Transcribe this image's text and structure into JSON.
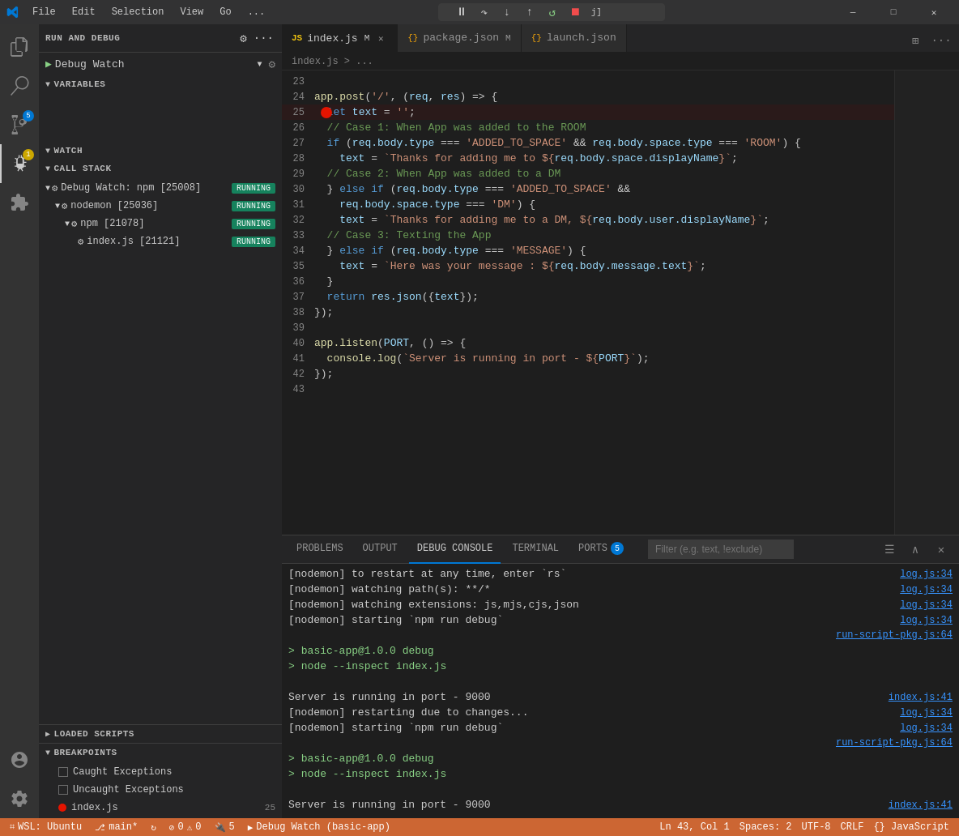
{
  "titleBar": {
    "menus": [
      "File",
      "Edit",
      "Selection",
      "View",
      "Go",
      "..."
    ],
    "windowControls": [
      "—",
      "□",
      "✕"
    ],
    "searchPlaceholder": ""
  },
  "debugControls": {
    "pause": "⏸",
    "stepOver": "↷",
    "stepInto": "↓",
    "stepOut": "↑",
    "restart": "↺",
    "stop": "⏹",
    "configLabel": "j]"
  },
  "activityBar": {
    "icons": [
      "explorer",
      "search",
      "source-control",
      "debug",
      "extensions",
      "accounts",
      "settings"
    ]
  },
  "sidebar": {
    "runDebugTitle": "RUN AND DEBUG",
    "debugConfig": "Debug Watch",
    "sections": {
      "variables": "VARIABLES",
      "watch": "WATCH",
      "callStack": "CALL STACK",
      "loadedScripts": "LOADED SCRIPTS",
      "breakpoints": "BREAKPOINTS"
    },
    "callStack": {
      "items": [
        {
          "label": "Debug Watch: npm [25008]",
          "status": "RUNNING",
          "indent": 0
        },
        {
          "label": "nodemon [25036]",
          "status": "RUNNING",
          "indent": 1
        },
        {
          "label": "npm [21078]",
          "status": "RUNNING",
          "indent": 2
        },
        {
          "label": "index.js [21121]",
          "status": "RUNNING",
          "indent": 3
        }
      ]
    },
    "breakpoints": {
      "items": [
        {
          "label": "Caught Exceptions",
          "type": "checkbox",
          "checked": false
        },
        {
          "label": "Uncaught Exceptions",
          "type": "checkbox",
          "checked": false
        },
        {
          "label": "index.js",
          "type": "breakpoint",
          "line": "25"
        }
      ]
    }
  },
  "tabs": [
    {
      "label": "index.js",
      "modified": true,
      "active": true,
      "icon": "JS"
    },
    {
      "label": "package.json",
      "modified": true,
      "active": false,
      "icon": "{}"
    },
    {
      "label": "launch.json",
      "modified": false,
      "active": false,
      "icon": "{}"
    }
  ],
  "breadcrumb": "index.js > ...",
  "code": {
    "lines": [
      {
        "num": 23,
        "content": ""
      },
      {
        "num": 24,
        "tokens": [
          {
            "t": "fn",
            "v": "app.post"
          },
          {
            "t": "punc",
            "v": "("
          },
          {
            "t": "str",
            "v": "'/'"
          },
          {
            "t": "punc",
            "v": ", ("
          },
          {
            "t": "var",
            "v": "req"
          },
          {
            "t": "punc",
            "v": ", "
          },
          {
            "t": "var",
            "v": "res"
          },
          {
            "t": "punc",
            "v": ") => {"
          }
        ]
      },
      {
        "num": 25,
        "tokens": [
          {
            "t": "sp",
            "v": "  "
          },
          {
            "t": "kw",
            "v": "let"
          },
          {
            "t": "punc",
            "v": " "
          },
          {
            "t": "var",
            "v": "text"
          },
          {
            "t": "punc",
            "v": " = "
          },
          {
            "t": "str",
            "v": "''"
          },
          {
            "t": "punc",
            "v": ";"
          }
        ],
        "breakpoint": true
      },
      {
        "num": 26,
        "tokens": [
          {
            "t": "sp",
            "v": "  "
          },
          {
            "t": "cmt",
            "v": "// Case 1: When App was added to the ROOM"
          }
        ]
      },
      {
        "num": 27,
        "tokens": [
          {
            "t": "sp",
            "v": "  "
          },
          {
            "t": "kw",
            "v": "if"
          },
          {
            "t": "punc",
            "v": " ("
          },
          {
            "t": "var",
            "v": "req.body.type"
          },
          {
            "t": "punc",
            "v": " === "
          },
          {
            "t": "str",
            "v": "'ADDED_TO_SPACE'"
          },
          {
            "t": "punc",
            "v": " && "
          },
          {
            "t": "var",
            "v": "req.body.space.type"
          },
          {
            "t": "punc",
            "v": " === "
          },
          {
            "t": "str",
            "v": "'ROOM'"
          },
          {
            "t": "punc",
            "v": ") {"
          }
        ]
      },
      {
        "num": 28,
        "tokens": [
          {
            "t": "sp",
            "v": "    "
          },
          {
            "t": "var",
            "v": "text"
          },
          {
            "t": "punc",
            "v": " = "
          },
          {
            "t": "tmpl",
            "v": "`Thanks for adding me to ${"
          },
          {
            "t": "var",
            "v": "req.body.space.displayName"
          },
          {
            "t": "tmpl",
            "v": "}`"
          },
          {
            "t": "punc",
            "v": ";"
          }
        ]
      },
      {
        "num": 29,
        "tokens": [
          {
            "t": "sp",
            "v": "  "
          },
          {
            "t": "cmt",
            "v": "// Case 2: When App was added to a DM"
          }
        ]
      },
      {
        "num": 30,
        "tokens": [
          {
            "t": "sp",
            "v": "  "
          },
          {
            "t": "punc",
            "v": "} "
          },
          {
            "t": "kw",
            "v": "else if"
          },
          {
            "t": "punc",
            "v": " ("
          },
          {
            "t": "var",
            "v": "req.body.type"
          },
          {
            "t": "punc",
            "v": " === "
          },
          {
            "t": "str",
            "v": "'ADDED_TO_SPACE'"
          },
          {
            "t": "punc",
            "v": " &&"
          }
        ]
      },
      {
        "num": 31,
        "tokens": [
          {
            "t": "sp",
            "v": "    "
          },
          {
            "t": "var",
            "v": "req.body.space.type"
          },
          {
            "t": "punc",
            "v": " === "
          },
          {
            "t": "str",
            "v": "'DM'"
          },
          {
            "t": "punc",
            "v": ") {"
          }
        ]
      },
      {
        "num": 32,
        "tokens": [
          {
            "t": "sp",
            "v": "    "
          },
          {
            "t": "var",
            "v": "text"
          },
          {
            "t": "punc",
            "v": " = "
          },
          {
            "t": "tmpl",
            "v": "`Thanks for adding me to a DM, ${"
          },
          {
            "t": "var",
            "v": "req.body.user.displayName"
          },
          {
            "t": "tmpl",
            "v": "}`"
          },
          {
            "t": "punc",
            "v": ";"
          }
        ]
      },
      {
        "num": 33,
        "tokens": [
          {
            "t": "sp",
            "v": "  "
          },
          {
            "t": "cmt",
            "v": "// Case 3: Texting the App"
          }
        ]
      },
      {
        "num": 34,
        "tokens": [
          {
            "t": "sp",
            "v": "  "
          },
          {
            "t": "punc",
            "v": "} "
          },
          {
            "t": "kw",
            "v": "else if"
          },
          {
            "t": "punc",
            "v": " ("
          },
          {
            "t": "var",
            "v": "req.body.type"
          },
          {
            "t": "punc",
            "v": " === "
          },
          {
            "t": "str",
            "v": "'MESSAGE'"
          },
          {
            "t": "punc",
            "v": ") {"
          }
        ]
      },
      {
        "num": 35,
        "tokens": [
          {
            "t": "sp",
            "v": "    "
          },
          {
            "t": "var",
            "v": "text"
          },
          {
            "t": "punc",
            "v": " = "
          },
          {
            "t": "tmpl",
            "v": "`Here was your message : ${"
          },
          {
            "t": "var",
            "v": "req.body.message.text"
          },
          {
            "t": "tmpl",
            "v": "}`"
          },
          {
            "t": "punc",
            "v": ";"
          }
        ]
      },
      {
        "num": 36,
        "tokens": [
          {
            "t": "sp",
            "v": "  "
          },
          {
            "t": "punc",
            "v": "}"
          }
        ]
      },
      {
        "num": 37,
        "tokens": [
          {
            "t": "sp",
            "v": "  "
          },
          {
            "t": "kw",
            "v": "return"
          },
          {
            "t": "punc",
            "v": " "
          },
          {
            "t": "var",
            "v": "res.json"
          },
          {
            "t": "punc",
            "v": "({"
          },
          {
            "t": "var",
            "v": "text"
          },
          {
            "t": "punc",
            "v": "});"
          }
        ]
      },
      {
        "num": 38,
        "tokens": [
          {
            "t": "punc",
            "v": "});"
          }
        ]
      },
      {
        "num": 39,
        "content": ""
      },
      {
        "num": 40,
        "tokens": [
          {
            "t": "fn",
            "v": "app.listen"
          },
          {
            "t": "punc",
            "v": "("
          },
          {
            "t": "var",
            "v": "PORT"
          },
          {
            "t": "punc",
            "v": ", () => {"
          }
        ]
      },
      {
        "num": 41,
        "tokens": [
          {
            "t": "sp",
            "v": "  "
          },
          {
            "t": "fn",
            "v": "console.log"
          },
          {
            "t": "punc",
            "v": "("
          },
          {
            "t": "tmpl",
            "v": "`Server is running in port - ${"
          },
          {
            "t": "var",
            "v": "PORT"
          },
          {
            "t": "tmpl",
            "v": "}`"
          },
          {
            "t": "punc",
            "v": ");"
          }
        ]
      },
      {
        "num": 42,
        "tokens": [
          {
            "t": "punc",
            "v": "});"
          }
        ]
      },
      {
        "num": 43,
        "content": ""
      }
    ]
  },
  "panel": {
    "tabs": [
      "PROBLEMS",
      "OUTPUT",
      "DEBUG CONSOLE",
      "TERMINAL",
      "PORTS"
    ],
    "portsCount": 5,
    "activeTab": "DEBUG CONSOLE",
    "filterPlaceholder": "Filter (e.g. text, !exclude)",
    "consoleLines": [
      {
        "text": "[nodemon] to restart at any time, enter `rs`",
        "ref": "log.js:34",
        "color": "normal"
      },
      {
        "text": "[nodemon] watching path(s): **/*",
        "ref": "log.js:34",
        "color": "normal"
      },
      {
        "text": "[nodemon] watching extensions: js,mjs,cjs,json",
        "ref": "log.js:34",
        "color": "normal"
      },
      {
        "text": "[nodemon] starting `npm run debug`",
        "ref": "log.js:34",
        "color": "normal"
      },
      {
        "text": "",
        "ref": "run-script-pkg.js:64",
        "color": "normal"
      },
      {
        "text": "> basic-app@1.0.0 debug",
        "ref": "",
        "color": "green",
        "prompt": true
      },
      {
        "text": "> node --inspect index.js",
        "ref": "",
        "color": "green",
        "prompt": true
      },
      {
        "text": "",
        "ref": "",
        "color": "normal"
      },
      {
        "text": "Server is running in port - 9000",
        "ref": "index.js:41",
        "color": "normal"
      },
      {
        "text": "[nodemon] restarting due to changes...",
        "ref": "log.js:34",
        "color": "normal"
      },
      {
        "text": "[nodemon] starting `npm run debug`",
        "ref": "log.js:34",
        "color": "normal"
      },
      {
        "text": "",
        "ref": "run-script-pkg.js:64",
        "color": "normal"
      },
      {
        "text": "> basic-app@1.0.0 debug",
        "ref": "",
        "color": "green",
        "prompt": true
      },
      {
        "text": "> node --inspect index.js",
        "ref": "",
        "color": "green",
        "prompt": true
      },
      {
        "text": "",
        "ref": "",
        "color": "normal"
      },
      {
        "text": "Server is running in port - 9000",
        "ref": "index.js:41",
        "color": "normal"
      }
    ]
  },
  "statusBar": {
    "left": [
      {
        "icon": "remote",
        "label": "WSL: Ubuntu"
      },
      {
        "icon": "branch",
        "label": "main*"
      },
      {
        "icon": "sync",
        "label": ""
      },
      {
        "icon": "error",
        "label": "0"
      },
      {
        "icon": "warning",
        "label": "0"
      },
      {
        "icon": "debug",
        "label": "5"
      },
      {
        "icon": "debug-watch",
        "label": "Debug Watch (basic-app)"
      }
    ],
    "right": [
      {
        "label": "Ln 43, Col 1"
      },
      {
        "label": "Spaces: 2"
      },
      {
        "label": "UTF-8"
      },
      {
        "label": "CRLF"
      },
      {
        "label": "{} JavaScript"
      }
    ]
  }
}
